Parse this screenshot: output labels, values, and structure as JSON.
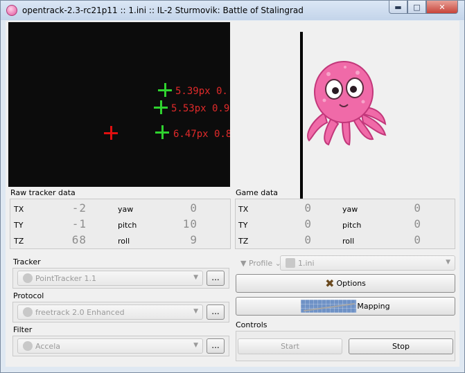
{
  "window": {
    "title": "opentrack-2.3-rc21p11 :: 1.ini :: IL-2 Sturmovik: Battle of Stalingrad",
    "minimize_glyph": "▬",
    "maximize_glyph": "□",
    "close_glyph": "✕"
  },
  "video": {
    "points": [
      {
        "label": "5.39px 0.",
        "color": "#2fd22f"
      },
      {
        "label": "5.53px 0.9",
        "color": "#2fd22f"
      },
      {
        "label": "6.47px 0.8",
        "color": "#2fd22f"
      }
    ],
    "center_marker_color": "#e01010"
  },
  "raw_tracker": {
    "title": "Raw tracker data",
    "rows": [
      {
        "axis": "TX",
        "value": "-2",
        "rot_axis": "yaw",
        "rot_value": "0"
      },
      {
        "axis": "TY",
        "value": "-1",
        "rot_axis": "pitch",
        "rot_value": "10"
      },
      {
        "axis": "TZ",
        "value": "68",
        "rot_axis": "roll",
        "rot_value": "9"
      }
    ]
  },
  "game_data": {
    "title": "Game data",
    "rows": [
      {
        "axis": "TX",
        "value": "0",
        "rot_axis": "yaw",
        "rot_value": "0"
      },
      {
        "axis": "TY",
        "value": "0",
        "rot_axis": "pitch",
        "rot_value": "0"
      },
      {
        "axis": "TZ",
        "value": "0",
        "rot_axis": "roll",
        "rot_value": "0"
      }
    ]
  },
  "tracker": {
    "title": "Tracker",
    "selected": "PointTracker 1.1",
    "settings_label": "..."
  },
  "protocol": {
    "title": "Protocol",
    "selected": "freetrack 2.0 Enhanced",
    "settings_label": "..."
  },
  "filter": {
    "title": "Filter",
    "selected": "Accela",
    "settings_label": "..."
  },
  "profile": {
    "label": "Profile",
    "selected": "1.ini"
  },
  "options": {
    "label": "Options"
  },
  "mapping": {
    "label": "Mapping"
  },
  "controls": {
    "title": "Controls",
    "start_label": "Start",
    "stop_label": "Stop"
  },
  "colors": {
    "accent_mapping": "#6f92c6",
    "octopus_pink": "#f06aa8"
  }
}
